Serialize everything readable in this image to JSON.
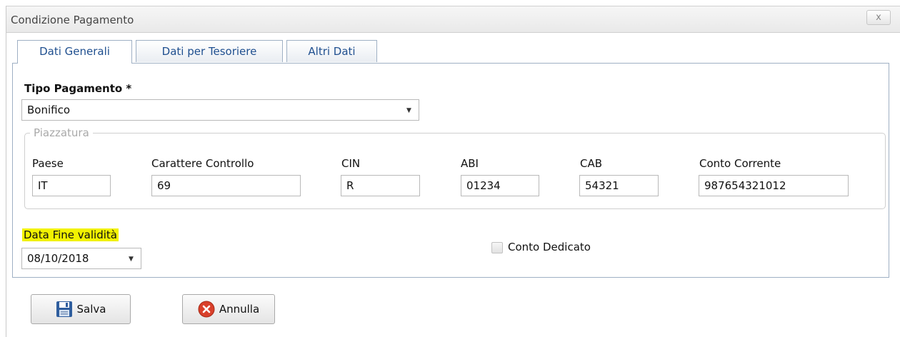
{
  "dialog": {
    "title": "Condizione Pagamento",
    "close_label": "x"
  },
  "tabs": [
    {
      "label": "Dati Generali",
      "active": true
    },
    {
      "label": "Dati per Tesoriere",
      "active": false
    },
    {
      "label": "Altri Dati",
      "active": false
    }
  ],
  "tipo_pagamento": {
    "label": "Tipo Pagamento",
    "required_mark": "*",
    "value": "Bonifico"
  },
  "piazzatura": {
    "legend": "Piazzatura",
    "fields": [
      {
        "label": "Paese",
        "value": "IT"
      },
      {
        "label": "Carattere Controllo",
        "value": "69"
      },
      {
        "label": "CIN",
        "value": "R"
      },
      {
        "label": "ABI",
        "value": "01234"
      },
      {
        "label": "CAB",
        "value": "54321"
      },
      {
        "label": "Conto Corrente",
        "value": "987654321012"
      }
    ]
  },
  "data_fine_validita": {
    "label": "Data Fine validità",
    "value": "08/10/2018",
    "highlight_color": "#f2f200"
  },
  "conto_dedicato": {
    "label": "Conto Dedicato",
    "checked": false
  },
  "buttons": {
    "save_label": "Salva",
    "cancel_label": "Annulla"
  },
  "colors": {
    "tab_text": "#1f4f8f",
    "border": "#9fb0c4"
  }
}
